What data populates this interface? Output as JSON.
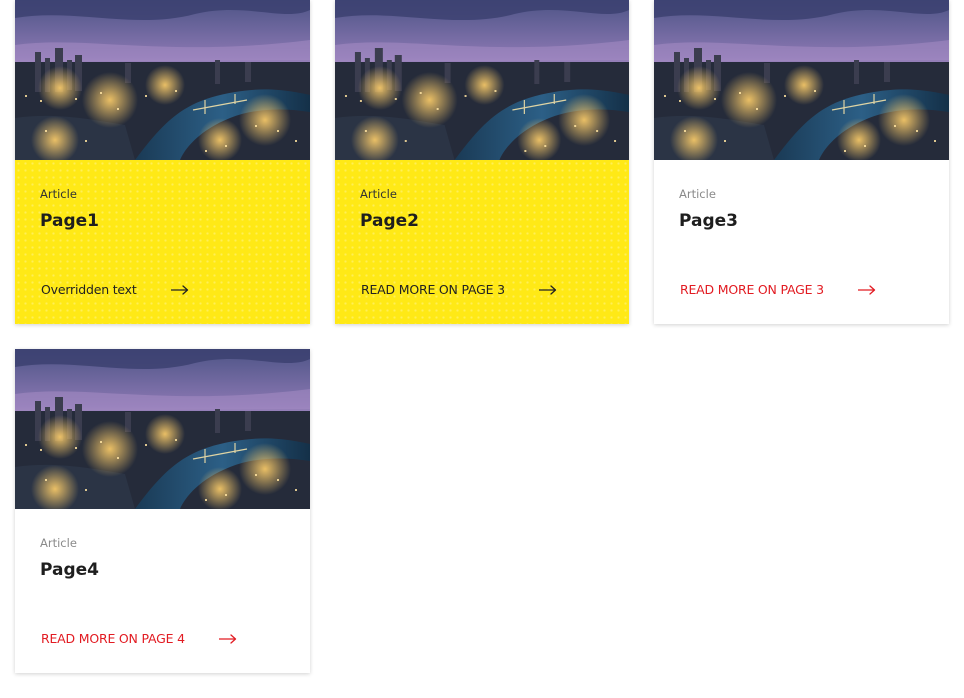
{
  "colors": {
    "accent_yellow": "#ffe916",
    "link_red": "#e21b22",
    "title_dark": "#1e1e1e"
  },
  "cards": [
    {
      "label": "Article",
      "title": "Page1",
      "cta": "Overridden text",
      "style": "yellow",
      "image": "city-night-skyline-image"
    },
    {
      "label": "Article",
      "title": "Page2",
      "cta": "READ MORE ON PAGE 3",
      "style": "yellow",
      "image": "city-night-skyline-image"
    },
    {
      "label": "Article",
      "title": "Page3",
      "cta": "READ MORE ON PAGE 3",
      "style": "white",
      "image": "city-night-skyline-image"
    },
    {
      "label": "Article",
      "title": "Page4",
      "cta": "READ MORE ON PAGE 4",
      "style": "white",
      "image": "city-night-skyline-image"
    }
  ],
  "icons": {
    "cta": "arrow-right-icon"
  }
}
